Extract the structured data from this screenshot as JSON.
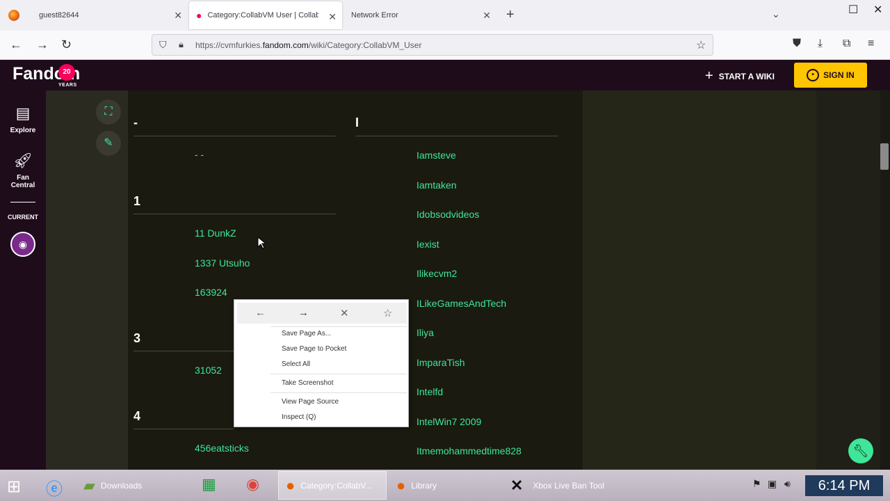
{
  "browser": {
    "tabs": [
      {
        "label": "guest82644"
      },
      {
        "label": "Category:CollabVM User | CollabVM"
      },
      {
        "label": "Network Error"
      }
    ],
    "url_prefix": "https://cvmfurkies.",
    "url_domain": "fandom.com",
    "url_path": "/wiki/Category:CollabVM_User"
  },
  "fandom": {
    "logo": "Fandom",
    "logo_badge": "20",
    "logo_years": "YEARS",
    "start_wiki": "START A WIKI",
    "sign_in": "SIGN IN"
  },
  "rail": {
    "explore": "Explore",
    "fan_central_1": "Fan",
    "fan_central_2": "Central",
    "current": "CURRENT"
  },
  "category": {
    "left_sections": [
      {
        "header": "-",
        "items": [
          "- -"
        ]
      },
      {
        "header": "1",
        "items": [
          "11 DunkZ",
          "1337 Utsuho",
          "163924"
        ]
      },
      {
        "header": "3",
        "items": [
          "31052"
        ]
      },
      {
        "header": "4",
        "items": [
          "456eatsticks"
        ]
      }
    ],
    "right_section": {
      "header": "I",
      "items": [
        "Iamsteve",
        "Iamtaken",
        "Idobsodvideos",
        "Iexist",
        "Ilikecvm2",
        "ILikeGamesAndTech",
        "Iliya",
        "ImparaTish",
        "Intelfd",
        "IntelWin7 2009",
        "Itmemohammedtime828"
      ]
    }
  },
  "context_menu": {
    "items": [
      "Save Page As...",
      "Save Page to Pocket",
      "Select All",
      "Take Screenshot",
      "View Page Source",
      "Inspect (Q)"
    ]
  },
  "taskbar": {
    "items": [
      "Downloads",
      "Category:CollabV...",
      "Library",
      "Xbox Live Ban Tool"
    ],
    "clock": "6:14 PM"
  },
  "colors": {
    "fandom_dark": "#1e0c1b",
    "link_green": "#3ee69a",
    "signin_yellow": "#ffc500",
    "fandom_pink": "#fa005a"
  }
}
